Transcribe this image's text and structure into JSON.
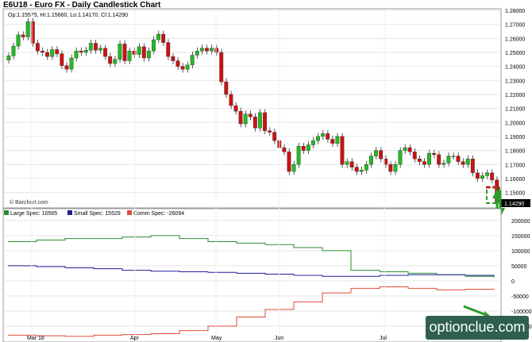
{
  "header": {
    "title": "E6U18 - Euro FX - Daily Candlestick Chart"
  },
  "chart_data": [
    {
      "type": "candlestick",
      "ohlc_label": "Op:1.15575, Hi:1.15660, Lo:1.14170, Cl:1.14290",
      "credit": "© Barchart.com",
      "last_price_label": "1.14290",
      "y_ticks": [
        "1.28000",
        "1.27000",
        "1.26000",
        "1.25000",
        "1.24000",
        "1.23000",
        "1.22000",
        "1.21000",
        "1.20000",
        "1.19000",
        "1.18000",
        "1.17000",
        "1.16000",
        "1.15000"
      ],
      "ylim": [
        1.139,
        1.28
      ],
      "x_ticks": [
        "Mar 18",
        "Apr",
        "May",
        "Jun",
        "Jul"
      ],
      "candles_close": [
        1.2475,
        1.2545,
        1.2625,
        1.261,
        1.272,
        1.2565,
        1.251,
        1.25,
        1.247,
        1.252,
        1.249,
        1.2405,
        1.238,
        1.246,
        1.251,
        1.25,
        1.2515,
        1.2565,
        1.2515,
        1.253,
        1.247,
        1.242,
        1.245,
        1.256,
        1.244,
        1.251,
        1.2485,
        1.254,
        1.246,
        1.251,
        1.259,
        1.263,
        1.257,
        1.247,
        1.244,
        1.24,
        1.238,
        1.241,
        1.248,
        1.251,
        1.253,
        1.251,
        1.253,
        1.25,
        1.229,
        1.22,
        1.212,
        1.208,
        1.199,
        1.206,
        1.204,
        1.196,
        1.207,
        1.194,
        1.193,
        1.187,
        1.182,
        1.179,
        1.165,
        1.17,
        1.183,
        1.18,
        1.184,
        1.187,
        1.19,
        1.192,
        1.188,
        1.185,
        1.19,
        1.17,
        1.172,
        1.168,
        1.165,
        1.166,
        1.17,
        1.176,
        1.18,
        1.174,
        1.17,
        1.165,
        1.17,
        1.18,
        1.182,
        1.179,
        1.174,
        1.172,
        1.17,
        1.178,
        1.177,
        1.17,
        1.171,
        1.176,
        1.176,
        1.172,
        1.17,
        1.174,
        1.164,
        1.16,
        1.162,
        1.164,
        1.159,
        1.1429
      ]
    },
    {
      "type": "line",
      "title": "COT",
      "series": [
        {
          "name": "Large Spec: 10565",
          "color": "#2e8b2e",
          "values": [
            130000,
            135000,
            140000,
            140000,
            145000,
            150000,
            140000,
            130000,
            125000,
            120000,
            110000,
            100000,
            35000,
            30000,
            25000,
            20000,
            15000,
            10565
          ]
        },
        {
          "name": "Small Spec: 15529",
          "color": "#1f1f9a",
          "values": [
            50000,
            47000,
            43000,
            40000,
            35000,
            32000,
            30000,
            28000,
            25000,
            22000,
            18000,
            15000,
            15000,
            18000,
            20000,
            20000,
            18000,
            15529
          ]
        },
        {
          "name": "Comm Spec: -26094",
          "color": "#e24a3a",
          "values": [
            -180000,
            -182000,
            -184000,
            -180000,
            -178000,
            -175000,
            -165000,
            -150000,
            -120000,
            -95000,
            -70000,
            -40000,
            -25000,
            -20000,
            -25000,
            -30000,
            -28000,
            -26094
          ]
        }
      ],
      "y_ticks": [
        "200000",
        "150000",
        "100000",
        "50000",
        "0",
        "-50000",
        "-100000",
        "-150000"
      ],
      "ylim": [
        -200000,
        210000
      ]
    }
  ],
  "watermark": {
    "text": "optionclue.com",
    "color": "#2e5f4f"
  }
}
